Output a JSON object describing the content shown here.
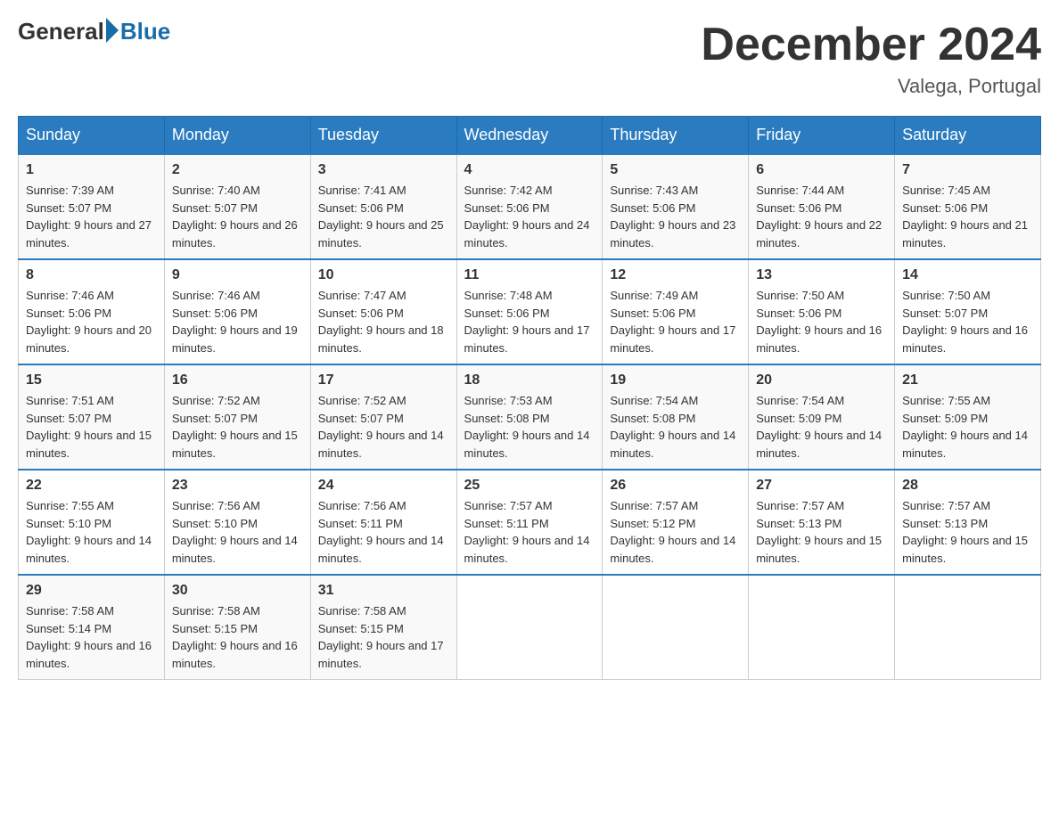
{
  "header": {
    "logo_general": "General",
    "logo_blue": "Blue",
    "month_title": "December 2024",
    "location": "Valega, Portugal"
  },
  "days_of_week": [
    "Sunday",
    "Monday",
    "Tuesday",
    "Wednesday",
    "Thursday",
    "Friday",
    "Saturday"
  ],
  "weeks": [
    [
      {
        "day": "1",
        "sunrise": "7:39 AM",
        "sunset": "5:07 PM",
        "daylight": "9 hours and 27 minutes."
      },
      {
        "day": "2",
        "sunrise": "7:40 AM",
        "sunset": "5:07 PM",
        "daylight": "9 hours and 26 minutes."
      },
      {
        "day": "3",
        "sunrise": "7:41 AM",
        "sunset": "5:06 PM",
        "daylight": "9 hours and 25 minutes."
      },
      {
        "day": "4",
        "sunrise": "7:42 AM",
        "sunset": "5:06 PM",
        "daylight": "9 hours and 24 minutes."
      },
      {
        "day": "5",
        "sunrise": "7:43 AM",
        "sunset": "5:06 PM",
        "daylight": "9 hours and 23 minutes."
      },
      {
        "day": "6",
        "sunrise": "7:44 AM",
        "sunset": "5:06 PM",
        "daylight": "9 hours and 22 minutes."
      },
      {
        "day": "7",
        "sunrise": "7:45 AM",
        "sunset": "5:06 PM",
        "daylight": "9 hours and 21 minutes."
      }
    ],
    [
      {
        "day": "8",
        "sunrise": "7:46 AM",
        "sunset": "5:06 PM",
        "daylight": "9 hours and 20 minutes."
      },
      {
        "day": "9",
        "sunrise": "7:46 AM",
        "sunset": "5:06 PM",
        "daylight": "9 hours and 19 minutes."
      },
      {
        "day": "10",
        "sunrise": "7:47 AM",
        "sunset": "5:06 PM",
        "daylight": "9 hours and 18 minutes."
      },
      {
        "day": "11",
        "sunrise": "7:48 AM",
        "sunset": "5:06 PM",
        "daylight": "9 hours and 17 minutes."
      },
      {
        "day": "12",
        "sunrise": "7:49 AM",
        "sunset": "5:06 PM",
        "daylight": "9 hours and 17 minutes."
      },
      {
        "day": "13",
        "sunrise": "7:50 AM",
        "sunset": "5:06 PM",
        "daylight": "9 hours and 16 minutes."
      },
      {
        "day": "14",
        "sunrise": "7:50 AM",
        "sunset": "5:07 PM",
        "daylight": "9 hours and 16 minutes."
      }
    ],
    [
      {
        "day": "15",
        "sunrise": "7:51 AM",
        "sunset": "5:07 PM",
        "daylight": "9 hours and 15 minutes."
      },
      {
        "day": "16",
        "sunrise": "7:52 AM",
        "sunset": "5:07 PM",
        "daylight": "9 hours and 15 minutes."
      },
      {
        "day": "17",
        "sunrise": "7:52 AM",
        "sunset": "5:07 PM",
        "daylight": "9 hours and 14 minutes."
      },
      {
        "day": "18",
        "sunrise": "7:53 AM",
        "sunset": "5:08 PM",
        "daylight": "9 hours and 14 minutes."
      },
      {
        "day": "19",
        "sunrise": "7:54 AM",
        "sunset": "5:08 PM",
        "daylight": "9 hours and 14 minutes."
      },
      {
        "day": "20",
        "sunrise": "7:54 AM",
        "sunset": "5:09 PM",
        "daylight": "9 hours and 14 minutes."
      },
      {
        "day": "21",
        "sunrise": "7:55 AM",
        "sunset": "5:09 PM",
        "daylight": "9 hours and 14 minutes."
      }
    ],
    [
      {
        "day": "22",
        "sunrise": "7:55 AM",
        "sunset": "5:10 PM",
        "daylight": "9 hours and 14 minutes."
      },
      {
        "day": "23",
        "sunrise": "7:56 AM",
        "sunset": "5:10 PM",
        "daylight": "9 hours and 14 minutes."
      },
      {
        "day": "24",
        "sunrise": "7:56 AM",
        "sunset": "5:11 PM",
        "daylight": "9 hours and 14 minutes."
      },
      {
        "day": "25",
        "sunrise": "7:57 AM",
        "sunset": "5:11 PM",
        "daylight": "9 hours and 14 minutes."
      },
      {
        "day": "26",
        "sunrise": "7:57 AM",
        "sunset": "5:12 PM",
        "daylight": "9 hours and 14 minutes."
      },
      {
        "day": "27",
        "sunrise": "7:57 AM",
        "sunset": "5:13 PM",
        "daylight": "9 hours and 15 minutes."
      },
      {
        "day": "28",
        "sunrise": "7:57 AM",
        "sunset": "5:13 PM",
        "daylight": "9 hours and 15 minutes."
      }
    ],
    [
      {
        "day": "29",
        "sunrise": "7:58 AM",
        "sunset": "5:14 PM",
        "daylight": "9 hours and 16 minutes."
      },
      {
        "day": "30",
        "sunrise": "7:58 AM",
        "sunset": "5:15 PM",
        "daylight": "9 hours and 16 minutes."
      },
      {
        "day": "31",
        "sunrise": "7:58 AM",
        "sunset": "5:15 PM",
        "daylight": "9 hours and 17 minutes."
      },
      null,
      null,
      null,
      null
    ]
  ]
}
